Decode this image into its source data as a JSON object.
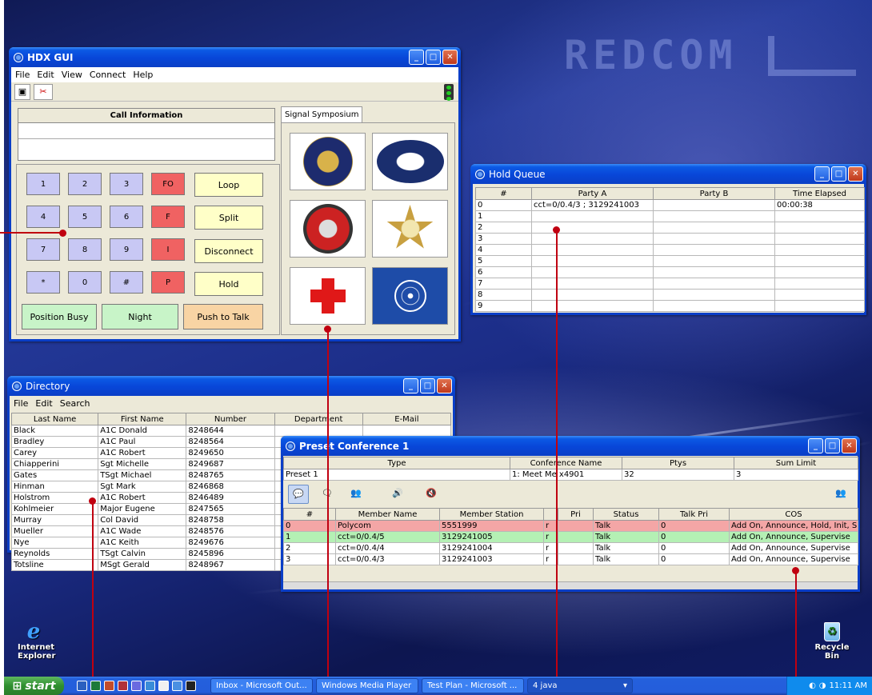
{
  "desktop": {
    "brand_logo": "REDCOM",
    "icons": {
      "ie": "Internet Explorer",
      "recycle": "Recycle Bin"
    }
  },
  "hdx": {
    "title": "HDX GUI",
    "menu": [
      "File",
      "Edit",
      "View",
      "Connect",
      "Help"
    ],
    "call_info_header": "Call Information",
    "tab": "Signal Symposium",
    "keys": [
      "1",
      "2",
      "3",
      "FO",
      "4",
      "5",
      "6",
      "F",
      "7",
      "8",
      "9",
      "I",
      "*",
      "0",
      "#",
      "P"
    ],
    "actions": [
      "Loop",
      "Split",
      "Disconnect",
      "Hold"
    ],
    "bottom": [
      "Position Busy",
      "Night",
      "Push to Talk"
    ],
    "symbols": [
      "army-national-guard-seal",
      "white-house-seal",
      "fire-dept-badge",
      "police-star-badge",
      "red-cross",
      "united-nations-flag"
    ]
  },
  "hold": {
    "title": "Hold Queue",
    "columns": [
      "#",
      "Party A",
      "Party B",
      "Time Elapsed"
    ],
    "rows": [
      [
        "0",
        "cct=0/0.4/3 ; 3129241003",
        "",
        "00:00:38"
      ],
      [
        "1",
        "",
        "",
        ""
      ],
      [
        "2",
        "",
        "",
        ""
      ],
      [
        "3",
        "",
        "",
        ""
      ],
      [
        "4",
        "",
        "",
        ""
      ],
      [
        "5",
        "",
        "",
        ""
      ],
      [
        "6",
        "",
        "",
        ""
      ],
      [
        "7",
        "",
        "",
        ""
      ],
      [
        "8",
        "",
        "",
        ""
      ],
      [
        "9",
        "",
        "",
        ""
      ]
    ]
  },
  "dir": {
    "title": "Directory",
    "menu": [
      "File",
      "Edit",
      "Search"
    ],
    "columns": [
      "Last Name",
      "First Name",
      "Number",
      "Department",
      "E-Mail"
    ],
    "rows": [
      [
        "Black",
        "A1C Donald",
        "8248644"
      ],
      [
        "Bradley",
        "A1C Paul",
        "8248564"
      ],
      [
        "Carey",
        "A1C Robert",
        "8249650"
      ],
      [
        "Chiapperini",
        "Sgt Michelle",
        "8249687"
      ],
      [
        "Gates",
        "TSgt Michael",
        "8248765"
      ],
      [
        "Hinman",
        "Sgt Mark",
        "8246868"
      ],
      [
        "Holstrom",
        "A1C Robert",
        "8246489"
      ],
      [
        "Kohlmeier",
        "Major Eugene",
        "8247565"
      ],
      [
        "Murray",
        "Col David",
        "8248758"
      ],
      [
        "Mueller",
        "A1C Wade",
        "8248576"
      ],
      [
        "Nye",
        "A1C Keith",
        "8249676"
      ],
      [
        "Reynolds",
        "TSgt Calvin",
        "8245896"
      ],
      [
        "Totsline",
        "MSgt Gerald",
        "8248967"
      ]
    ]
  },
  "conf": {
    "title": "Preset Conference 1",
    "head_cols": [
      "Type",
      "Conference Name",
      "Ptys",
      "Sum Limit"
    ],
    "head_vals": [
      "Preset 1",
      "1: Meet Me x4901",
      "32",
      "3"
    ],
    "columns": [
      "#",
      "Member Name",
      "Member Station",
      "",
      "Pri",
      "Status",
      "Talk Pri",
      "COS"
    ],
    "rows": [
      {
        "c": [
          "0",
          "Polycom",
          "5551999",
          "r",
          "",
          "Talk",
          "0",
          "Add On, Announce, Hold, Init, S..."
        ],
        "color": "#f4a6a6"
      },
      {
        "c": [
          "1",
          "cct=0/0.4/5",
          "3129241005",
          "r",
          "",
          "Talk",
          "0",
          "Add On, Announce, Supervise"
        ],
        "color": "#b4f0b4"
      },
      {
        "c": [
          "2",
          "cct=0/0.4/4",
          "3129241004",
          "r",
          "",
          "Talk",
          "0",
          "Add On, Announce, Supervise"
        ],
        "color": "#ffffff"
      },
      {
        "c": [
          "3",
          "cct=0/0.4/3",
          "3129241003",
          "r",
          "",
          "Talk",
          "0",
          "Add On, Announce, Supervise"
        ],
        "color": "#ffffff"
      }
    ]
  },
  "taskbar": {
    "start": "start",
    "tasks": [
      "Inbox - Microsoft Out...",
      "Windows Media Player",
      "Test Plan - Microsoft ...",
      "4 java"
    ],
    "clock": "11:11 AM"
  },
  "colors": {
    "callout": "#c00010",
    "titlebar": "#0846d8",
    "key": "#c8c8f4",
    "fkey": "#f06262"
  }
}
